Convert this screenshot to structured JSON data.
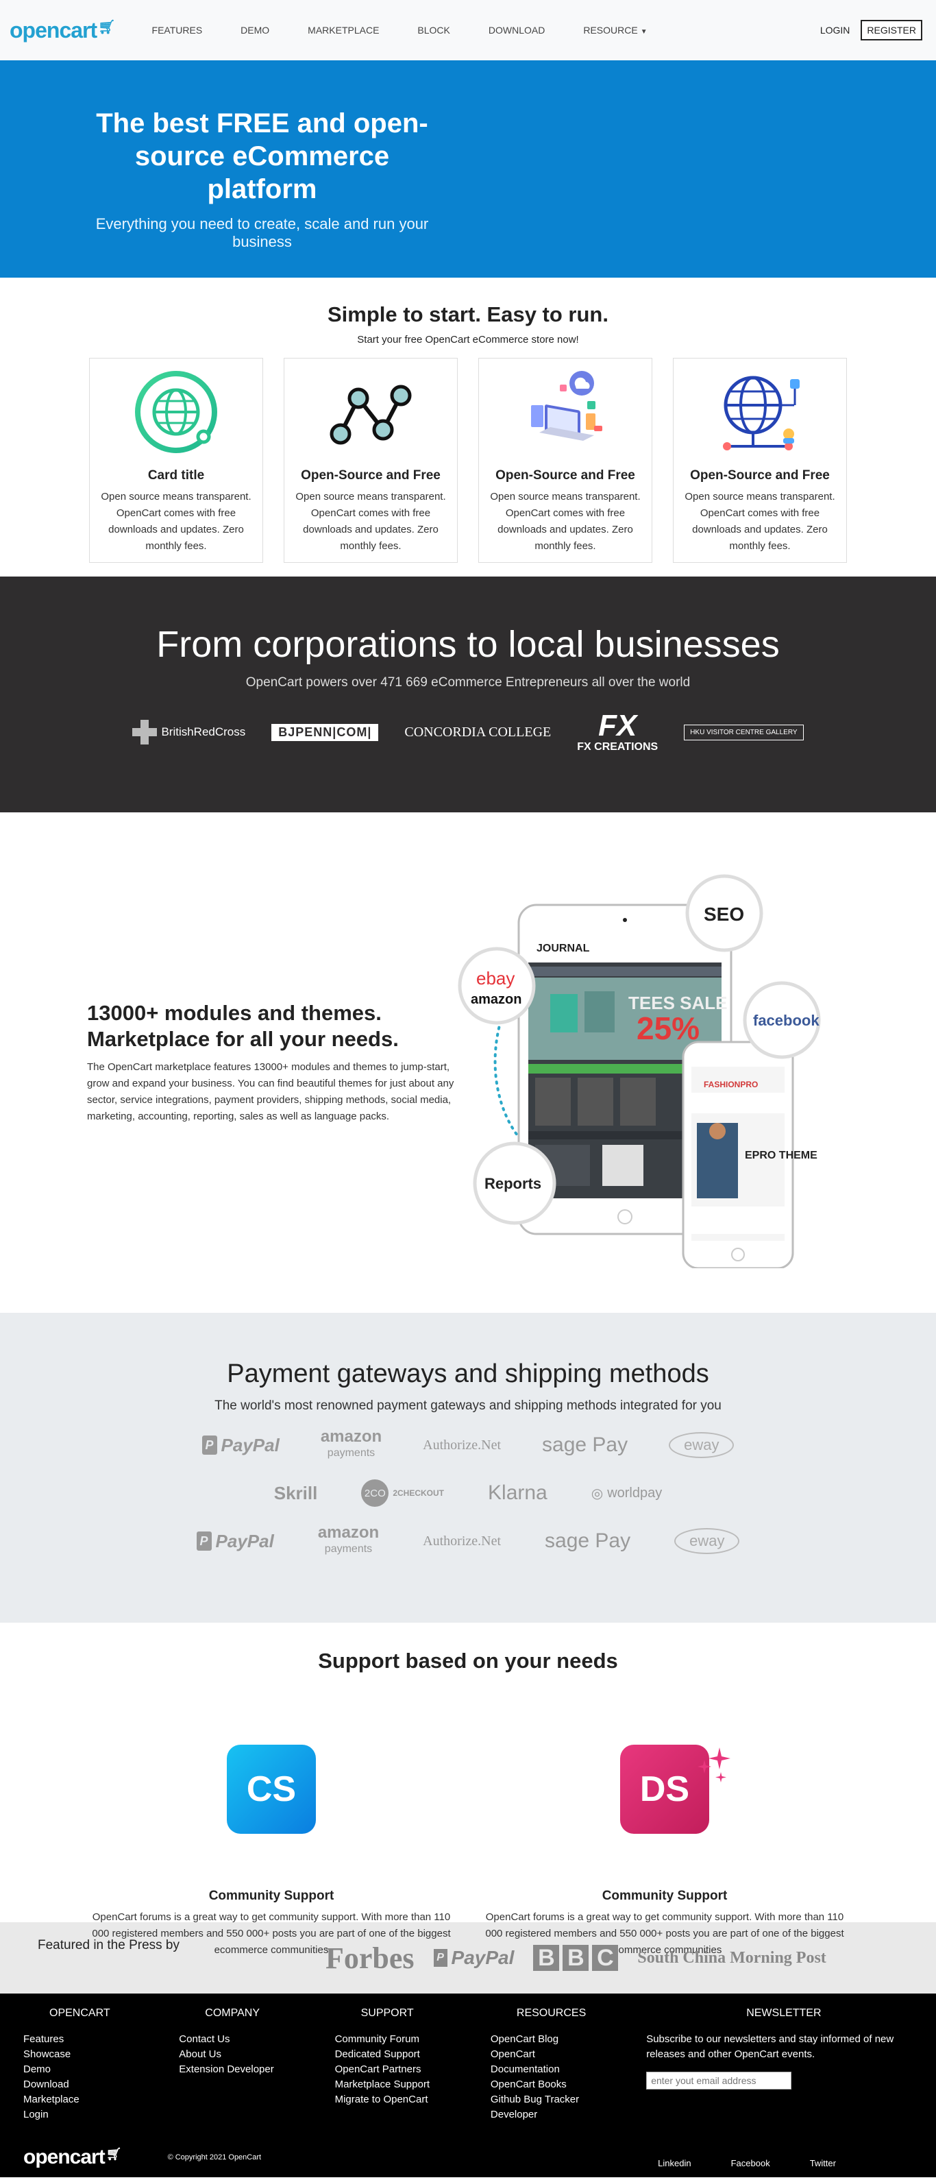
{
  "nav": {
    "logo": "opencart",
    "links": [
      "FEATURES",
      "DEMO",
      "MARKETPLACE",
      "BLOCK",
      "DOWNLOAD",
      "RESOURCE"
    ],
    "login": "LOGIN",
    "register": "REGISTER"
  },
  "hero": {
    "title": "The best FREE and open-source eCommerce platform",
    "subtitle": "Everything you need to create, scale and run your business"
  },
  "simple": {
    "title": "Simple to start. Easy to run.",
    "subtitle": "Start your free OpenCart eCommerce store now!",
    "cards": [
      {
        "title": "Card title",
        "text": "Open source means transparent. OpenCart comes with free downloads and updates. Zero monthly fees.",
        "icon": "globe-icon"
      },
      {
        "title": "Open-Source and Free",
        "text": "Open source means transparent. OpenCart comes with free downloads and updates. Zero monthly fees.",
        "icon": "network-icon"
      },
      {
        "title": "Open-Source and Free",
        "text": "Open source means transparent. OpenCart comes with free downloads and updates. Zero monthly fees.",
        "icon": "devices-icon"
      },
      {
        "title": "Open-Source and Free",
        "text": "Open source means transparent. OpenCart comes with free downloads and updates. Zero monthly fees.",
        "icon": "globe-network-icon"
      }
    ]
  },
  "corp": {
    "title": "From corporations to local businesses",
    "subtitle": "OpenCart powers over 471 669 eCommerce Entrepreneurs all over the world",
    "brands": [
      "BritishRedCross",
      "BJPENN|COM|",
      "CONCORDIA COLLEGE",
      "FX",
      "FX CREATIONS",
      "HKU VISITOR CENTRE GALLERY"
    ]
  },
  "modules": {
    "title": "13000+ modules and themes. Marketplace for all your needs.",
    "text": "The OpenCart marketplace features 13000+ modules and themes to jump-start, grow and expand your business. You can find beautiful themes for just about any sector, service integrations, payment providers, shipping methods, social media, marketing, accounting, reporting, sales as well as language packs.",
    "bubbles": {
      "seo": "SEO",
      "ebay": "ebay",
      "amazon": "amazon",
      "facebook": "facebook",
      "reports": "Reports"
    },
    "tablet": {
      "brand": "JOURNAL",
      "banner": "TEES SALE",
      "percent": "25%"
    },
    "phone": {
      "brand": "FASHIONPRO",
      "theme": "EPRO THEME"
    }
  },
  "payment": {
    "title": "Payment gateways and shipping methods",
    "subtitle": "The world's most renowned payment gateways and shipping methods integrated for you",
    "row1": [
      "PayPal",
      "amazon",
      "payments",
      "Authorize.Net",
      "sage Pay",
      "eway"
    ],
    "row2": [
      "Skrill",
      "2CO",
      "2CHECKOUT",
      "Klarna",
      "worldpay"
    ],
    "row3": [
      "PayPal",
      "amazon",
      "payments",
      "Authorize.Net",
      "sage Pay",
      "eway"
    ]
  },
  "support": {
    "title": "Support based on your needs",
    "cols": [
      {
        "badge": "CS",
        "title": "Community Support",
        "text": "OpenCart forums is a great way to get community support. With more than 110 000 registered members and 550 000+ posts you are part of one of the biggest ecommerce communities"
      },
      {
        "badge": "DS",
        "title": "Community Support",
        "text": "OpenCart forums is a great way to get community support. With more than 110 000 registered members and 550 000+ posts you are part of one of the biggest ecommerce communities"
      }
    ]
  },
  "press": {
    "label": "Featured in the Press by",
    "logos": [
      "Forbes",
      "PayPal",
      "B",
      "B",
      "C",
      "South China Morning Post"
    ]
  },
  "footer": {
    "cols": [
      {
        "title": "OPENCART",
        "links": [
          "Features",
          "Showcase",
          "Demo",
          "Download",
          "Marketplace",
          "Login"
        ]
      },
      {
        "title": "COMPANY",
        "links": [
          "Contact Us",
          "About Us",
          "Extension Developer"
        ]
      },
      {
        "title": "SUPPORT",
        "links": [
          "Community Forum",
          "Dedicated Support",
          "OpenCart Partners",
          "Marketplace Support",
          "Migrate to OpenCart"
        ]
      },
      {
        "title": "RESOURCES",
        "links": [
          "OpenCart Blog",
          "OpenCart",
          "Documentation",
          "OpenCart Books",
          "Github Bug Tracker",
          "Developer"
        ]
      }
    ],
    "newsletter": {
      "title": "NEWSLETTER",
      "text": "Subscribe to our newsletters and stay informed of new releases and other OpenCart events.",
      "placeholder": "enter yout email address"
    },
    "logo": "opencart",
    "copyright": "© Copyright 2021 OpenCart",
    "socials": [
      "Linkedin",
      "Facebook",
      "Twitter"
    ]
  },
  "colors": {
    "brand": "#23a1d1",
    "hero": "#0a82cf",
    "dark": "#2f2d2e",
    "light": "#e9ecef",
    "footer": "#000000"
  }
}
